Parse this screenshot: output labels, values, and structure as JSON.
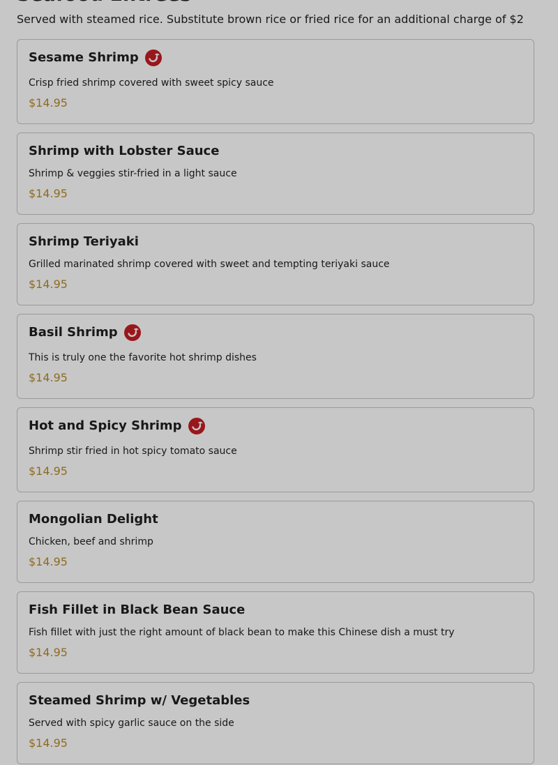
{
  "section": {
    "title": "Seafood Entrees",
    "description": "Served with steamed rice. Substitute brown rice or fried rice for an additional charge of $2"
  },
  "items": [
    {
      "name": "Sesame Shrimp",
      "description": "Crisp fried shrimp covered with sweet spicy sauce",
      "price": "$14.95",
      "spicy": true
    },
    {
      "name": "Shrimp with Lobster Sauce",
      "description": "Shrimp & veggies stir-fried in a light sauce",
      "price": "$14.95",
      "spicy": false
    },
    {
      "name": "Shrimp Teriyaki",
      "description": "Grilled marinated shrimp covered with sweet and tempting teriyaki sauce",
      "price": "$14.95",
      "spicy": false
    },
    {
      "name": "Basil Shrimp",
      "description": "This is truly one the favorite hot shrimp dishes",
      "price": "$14.95",
      "spicy": true
    },
    {
      "name": "Hot and Spicy Shrimp",
      "description": "Shrimp stir fried in hot spicy tomato sauce",
      "price": "$14.95",
      "spicy": true
    },
    {
      "name": "Mongolian Delight",
      "description": "Chicken, beef and shrimp",
      "price": "$14.95",
      "spicy": false
    },
    {
      "name": "Fish Fillet in Black Bean Sauce",
      "description": "Fish fillet with just the right amount of black bean to make this Chinese dish a must try",
      "price": "$14.95",
      "spicy": false
    },
    {
      "name": "Steamed Shrimp w/ Vegetables",
      "description": "Served with spicy garlic sauce on the side",
      "price": "$14.95",
      "spicy": false
    }
  ],
  "icons": {
    "spicy": "chili-pepper-icon"
  },
  "colors": {
    "price": "#b88a2a",
    "spicy_icon": "#c41e24",
    "card_border": "#c6c6c6"
  }
}
